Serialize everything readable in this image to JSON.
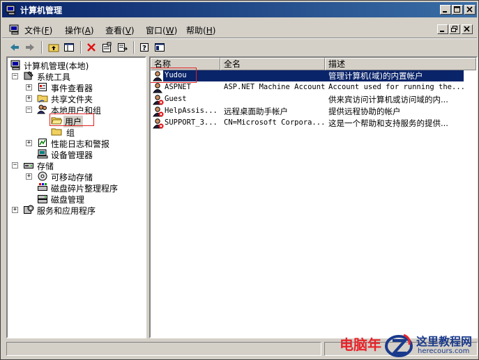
{
  "window": {
    "title": "计算机管理"
  },
  "menubar": {
    "items": [
      {
        "label": "文件",
        "key": "F"
      },
      {
        "label": "操作",
        "key": "A"
      },
      {
        "label": "查看",
        "key": "V"
      },
      {
        "label": "窗口",
        "key": "W"
      },
      {
        "label": "帮助",
        "key": "H"
      }
    ]
  },
  "tree": {
    "root": "计算机管理(本地)",
    "system_tools": "系统工具",
    "event_viewer": "事件查看器",
    "shared_folders": "共享文件夹",
    "local_users_groups": "本地用户和组",
    "users": "用户",
    "groups": "组",
    "perf_logs": "性能日志和警报",
    "device_manager": "设备管理器",
    "storage": "存储",
    "removable_storage": "可移动存储",
    "defrag": "磁盘碎片整理程序",
    "disk_mgmt": "磁盘管理",
    "services_apps": "服务和应用程序"
  },
  "list": {
    "columns": [
      "名称",
      "全名",
      "描述"
    ],
    "rows": [
      {
        "name": "Yudou",
        "fullname": "",
        "desc": "管理计算机(域)的内置帐户",
        "disabled": false,
        "selected": true
      },
      {
        "name": "ASPNET",
        "fullname": "ASP.NET Machine Account",
        "desc": "Account used for running the...",
        "disabled": false,
        "selected": false
      },
      {
        "name": "Guest",
        "fullname": "",
        "desc": "供来宾访问计算机或访问域的内...",
        "disabled": true,
        "selected": false
      },
      {
        "name": "HelpAssis...",
        "fullname": "远程桌面助手帐户",
        "desc": "提供远程协助的帐户",
        "disabled": true,
        "selected": false
      },
      {
        "name": "SUPPORT_3...",
        "fullname": "CN=Microsoft Corpora...",
        "desc": "这是一个帮助和支持服务的提供...",
        "disabled": true,
        "selected": false
      }
    ]
  },
  "watermark": {
    "left_text": "电脑年",
    "title": "这里教程网",
    "url": "herecours.com"
  },
  "colors": {
    "title_bar": "#0a246a",
    "selection": "#0a246a",
    "highlight_box": "#e02020",
    "watermark_red": "#e8242a",
    "watermark_blue": "#1a3a8c"
  }
}
